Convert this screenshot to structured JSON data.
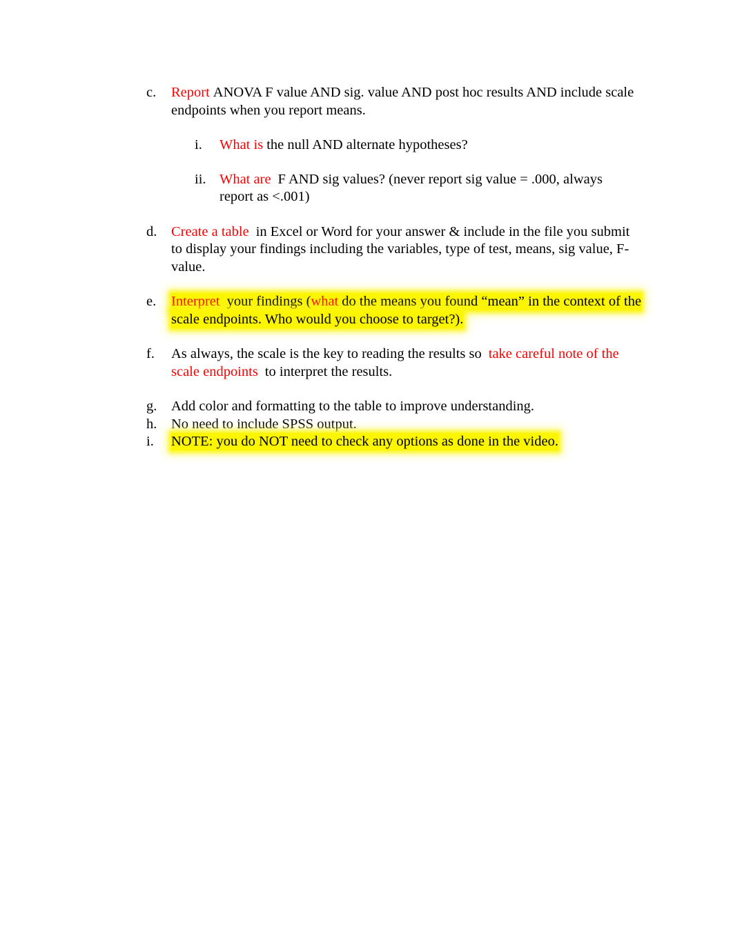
{
  "document": {
    "page_background": "#ffffff",
    "text_color": "#000000",
    "accent_color": "#ff0000",
    "highlight_color": "#fbf500"
  },
  "outline": {
    "item_c": {
      "marker": "c.",
      "lead_red": "Report",
      "text": "ANOVA F value AND sig. value AND post hoc results AND include scale endpoints when you report means."
    },
    "item_c_sub": {
      "item_i": {
        "marker": "i.",
        "lead_red": "What is",
        "text": "the null AND alternate hypotheses?"
      },
      "item_ii": {
        "marker": "ii.",
        "lead_red": "What are",
        "text": "F AND sig values? (never report sig value = .000, always report as <.001)"
      }
    },
    "item_d": {
      "marker": "d.",
      "lead_red": "Create a table",
      "text": "in Excel or Word for your answer & include in the file you submit to display your findings including the variables, type of test, means, sig value, F-value."
    },
    "item_e": {
      "marker": "e.",
      "lead_red": "Interpret",
      "text_before": "your findings (",
      "inline_red": "what",
      "text_after": "do the means you found “mean” in the context of the scale endpoints. Who would you choose to target?).",
      "highlighted": true
    },
    "item_f": {
      "marker": "f.",
      "text_before": "As always, the scale is the key to reading the results so",
      "inline_red": "take careful note of the scale endpoints",
      "text_after": "to interpret the results."
    },
    "item_g": {
      "marker": "g.",
      "text": "Add color and formatting to the table to improve understanding."
    },
    "item_h": {
      "marker": "h.",
      "text": "No need to include SPSS output."
    },
    "item_i": {
      "marker": "i.",
      "text": "NOTE: you do NOT need to check any options as done in the video.",
      "highlighted": true
    }
  }
}
